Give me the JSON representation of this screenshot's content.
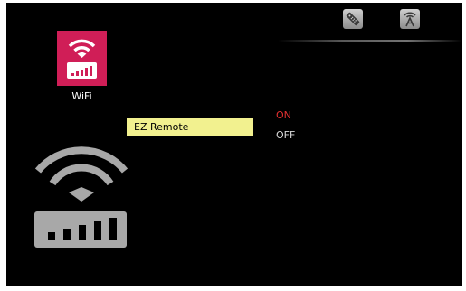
{
  "status_bar": {
    "icons": [
      "remote-control-icon",
      "antenna-icon"
    ]
  },
  "wifi_tile": {
    "label": "WiFi",
    "color": "#d01e57"
  },
  "menu": {
    "selected_item": "EZ Remote",
    "highlight_color": "#f2f18f"
  },
  "options": {
    "on_label": "ON",
    "off_label": "OFF",
    "active": "ON",
    "active_color": "#e23030"
  }
}
